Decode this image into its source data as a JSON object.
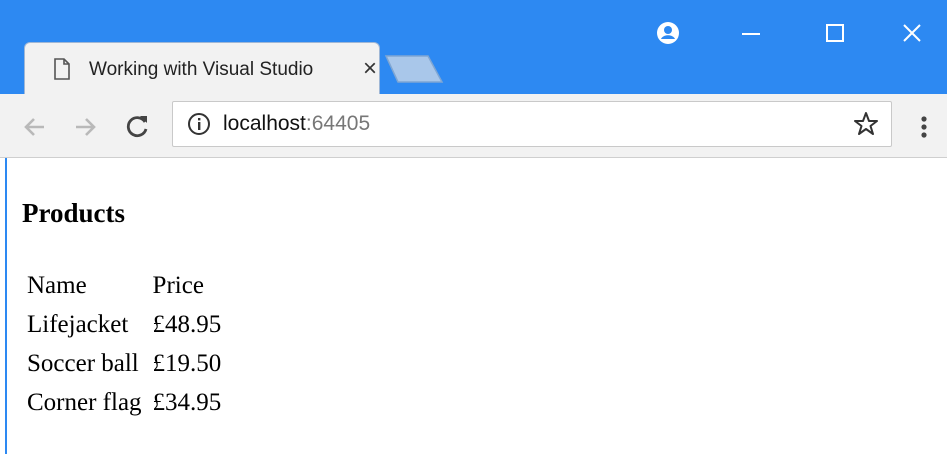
{
  "browser": {
    "tab": {
      "title": "Working with Visual Studio",
      "close_label": "×"
    },
    "window_controls": {
      "minimize_label": "—",
      "maximize_label": "☐",
      "close_label": "✕"
    },
    "address": {
      "host": "localhost",
      "port": ":64405"
    },
    "colors": {
      "accent": "#2d89f2",
      "toolbar": "#f2f2f2"
    }
  },
  "page": {
    "title": "Products",
    "table": {
      "headers": [
        "Name",
        "Price"
      ],
      "rows": [
        [
          "Lifejacket",
          "£48.95"
        ],
        [
          "Soccer ball",
          "£19.50"
        ],
        [
          "Corner flag",
          "£34.95"
        ]
      ]
    }
  }
}
